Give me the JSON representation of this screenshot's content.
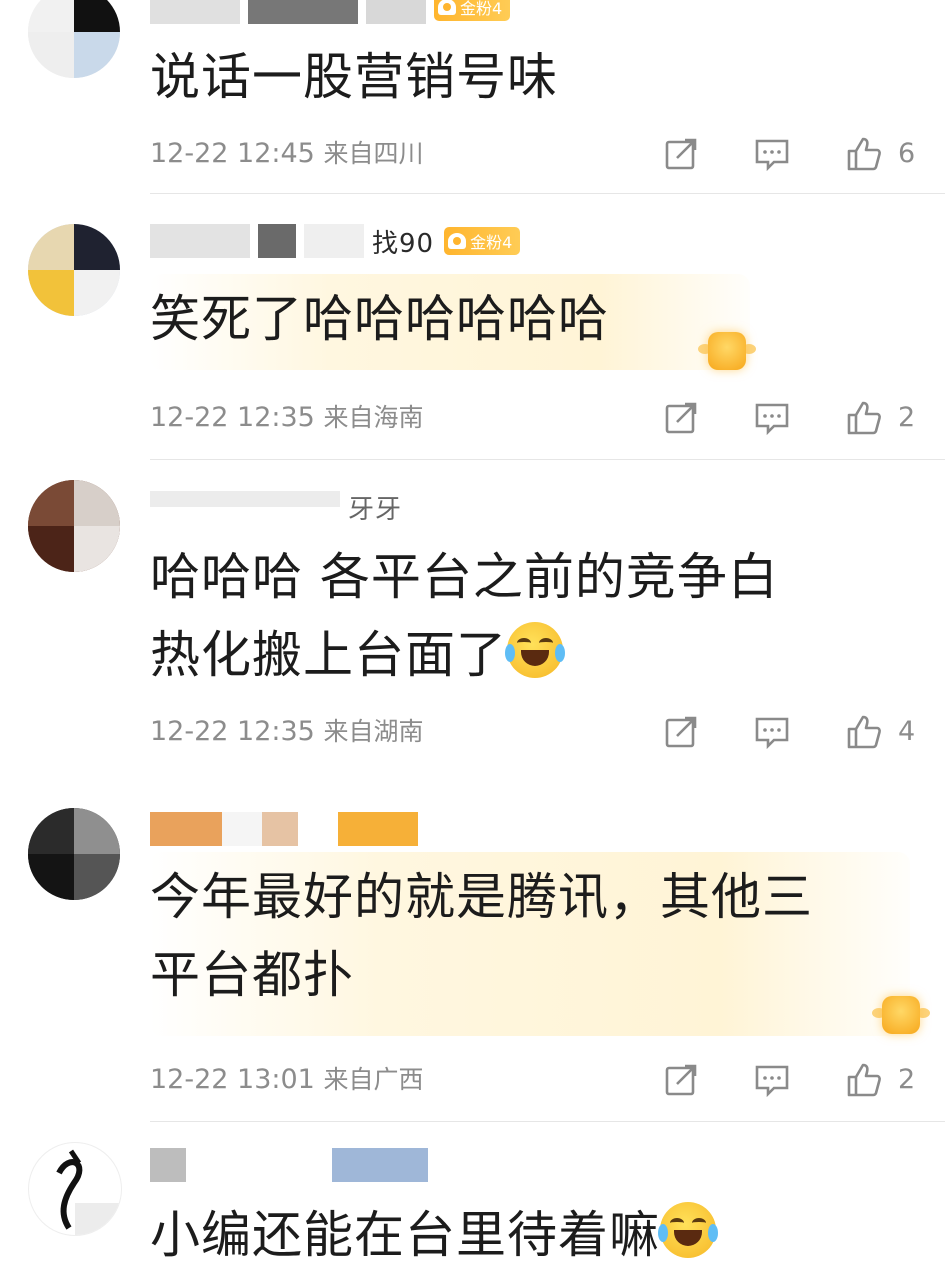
{
  "comments": [
    {
      "badge": "金粉4",
      "text": "说话一股营销号味",
      "time": "12-22 12:45",
      "location": "来自四川",
      "likes": "6"
    },
    {
      "name_visible": "找90",
      "badge": "金粉4",
      "text": "笑死了哈哈哈哈哈哈",
      "time": "12-22 12:35",
      "location": "来自海南",
      "likes": "2"
    },
    {
      "name_visible": "牙牙",
      "text_line1": "哈哈哈 各平台之前的竞争白",
      "text_line2": "热化搬上台面了",
      "time": "12-22 12:35",
      "location": "来自湖南",
      "likes": "4"
    },
    {
      "text_line1": "今年最好的就是腾讯，其他三",
      "text_line2": "平台都扑",
      "time": "12-22 13:01",
      "location": "来自广西",
      "likes": "2"
    },
    {
      "text": "小编还能在台里待着嘛"
    }
  ],
  "icons": {
    "share": "share-icon",
    "reply": "comment-icon",
    "like": "thumbs-up-icon",
    "emoji": "laughing-tears-emoji"
  }
}
